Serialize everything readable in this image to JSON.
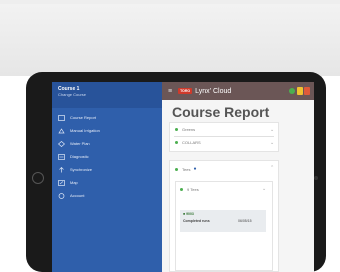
{
  "sidebar": {
    "title": "Course 1",
    "subtitle": "Change Course",
    "items": [
      {
        "label": "Course Report",
        "icon": "report-icon"
      },
      {
        "label": "Manual Irrigation",
        "icon": "irrigation-icon"
      },
      {
        "label": "Water Plan",
        "icon": "water-plan-icon"
      },
      {
        "label": "Diagnostic",
        "icon": "diagnostic-icon"
      },
      {
        "label": "Synchronize",
        "icon": "sync-icon"
      },
      {
        "label": "Map",
        "icon": "map-icon"
      },
      {
        "label": "Account",
        "icon": "account-icon"
      }
    ]
  },
  "topbar": {
    "badge": "TORO",
    "brand": "Lynx' Cloud",
    "status_colors": [
      "#4caf50",
      "#f2c230",
      "#e05a3a"
    ]
  },
  "main": {
    "title": "Course Report",
    "greens_label": "Greens",
    "collars_label": "COLLARS",
    "tees_label": "Tees",
    "tees_sub_label": "9 Tees",
    "table_id": "9003",
    "table_row_label": "Completed runs",
    "table_row_value": "06/05/15"
  },
  "colors": {
    "sidebar": "#2f5fab",
    "topbar": "#6b5656",
    "accent_green": "#4caf50"
  }
}
